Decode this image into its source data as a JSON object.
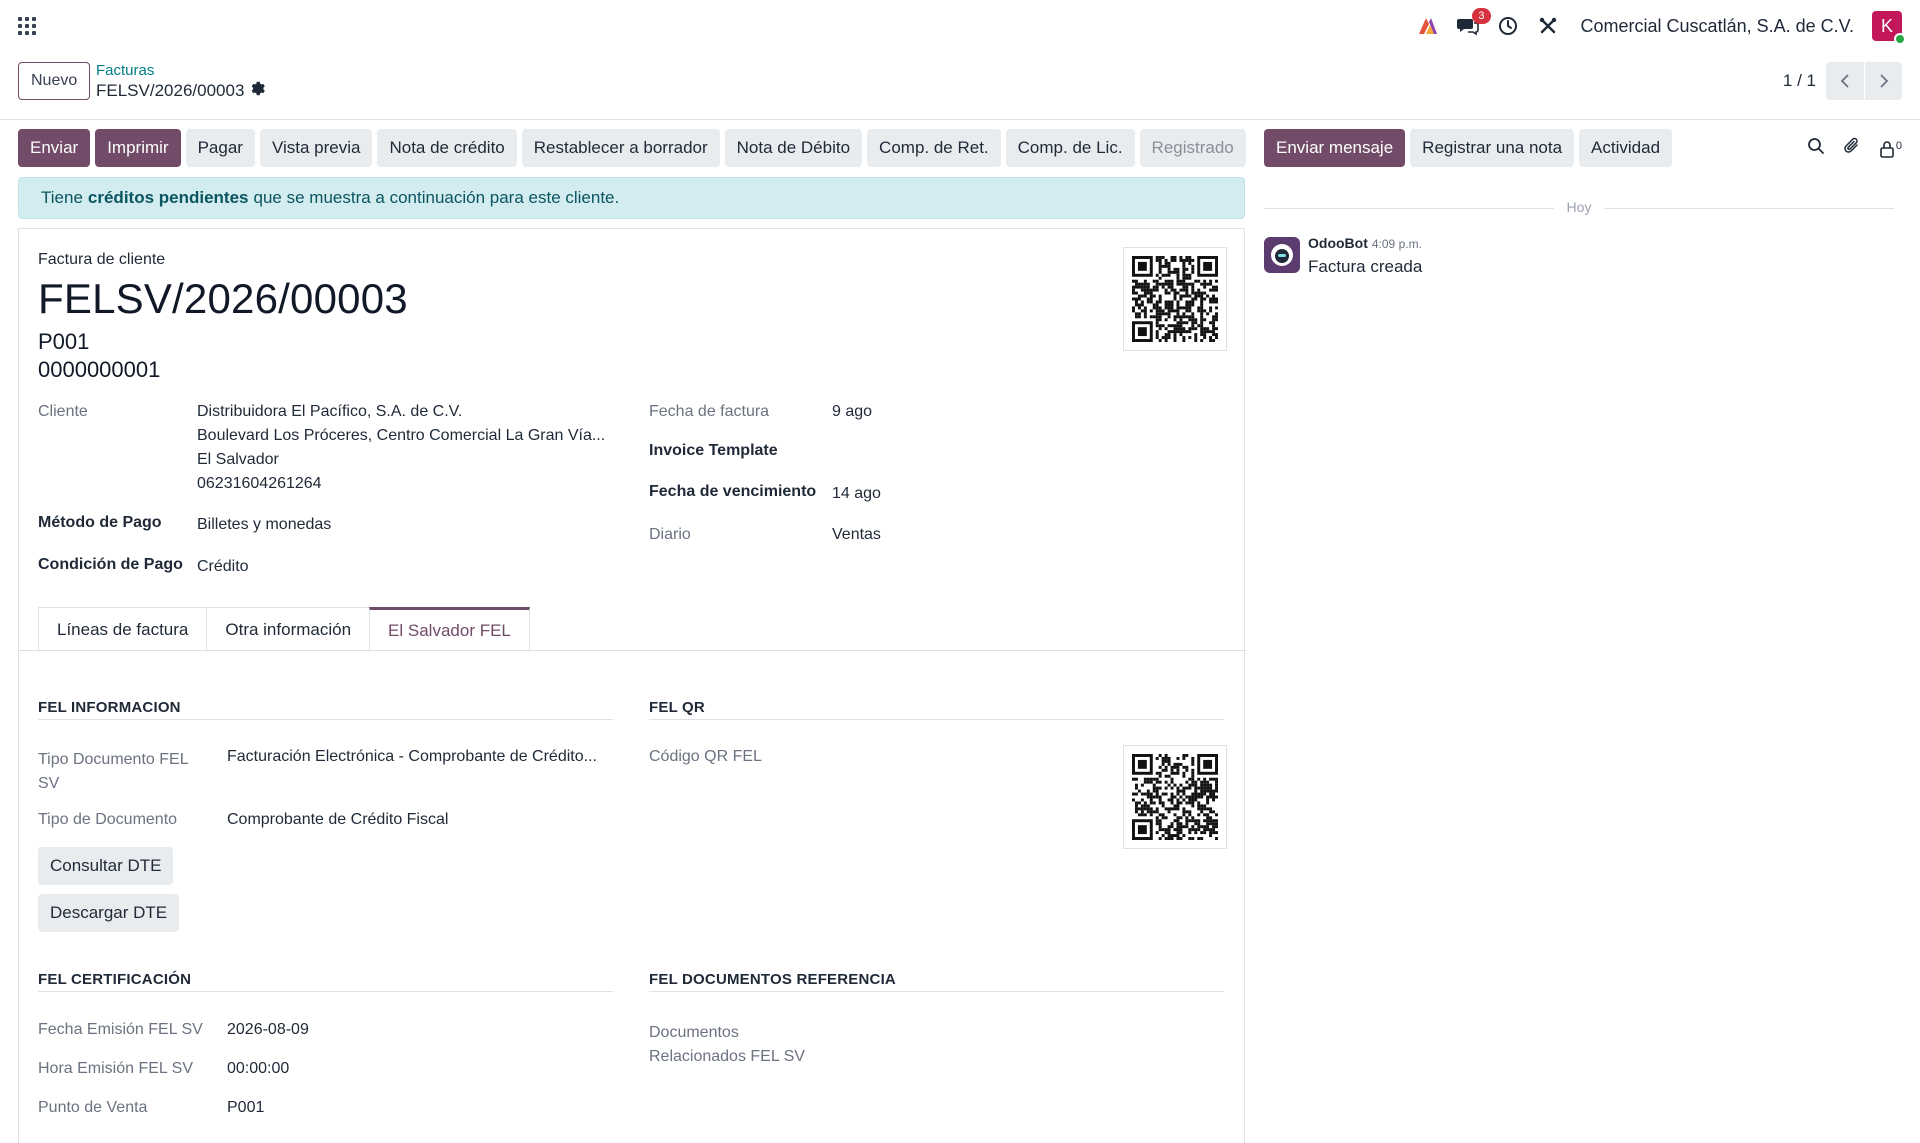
{
  "navbar": {
    "company": "Comercial Cuscatlán, S.A. de C.V.",
    "messages_badge": "3",
    "avatar_initial": "K"
  },
  "control_panel": {
    "new_label": "Nuevo",
    "breadcrumb_parent": "Facturas",
    "breadcrumb_current": "FELSV/2026/00003",
    "pager": "1 / 1"
  },
  "statusbar": {
    "buttons": [
      "Enviar",
      "Imprimir",
      "Pagar",
      "Vista previa",
      "Nota de crédito",
      "Restablecer a borrador",
      "Nota de Débito",
      "Comp. de Ret.",
      "Comp. de Lic."
    ],
    "state": "Registrado"
  },
  "alert": {
    "prefix": "Tiene",
    "bold": "créditos pendientes",
    "suffix": "que se muestra a continuación para este cliente."
  },
  "invoice": {
    "doc_type": "Factura de cliente",
    "number": "FELSV/2026/00003",
    "pos_code": "P001",
    "control_number": "0000000001",
    "customer_label": "Cliente",
    "customer_name": "Distribuidora El Pacífico, S.A. de C.V.",
    "customer_address": "Boulevard Los Próceres, Centro Comercial La Gran Vía...",
    "customer_country": "El Salvador",
    "customer_nit": "06231604261264",
    "payment_method_label": "Método de Pago",
    "payment_method": "Billetes y monedas",
    "payment_condition_label": "Condición de Pago",
    "payment_condition": "Crédito",
    "invoice_date_label": "Fecha de factura",
    "invoice_date": "9 ago",
    "invoice_template_label": "Invoice Template",
    "due_date_label": "Fecha de vencimiento",
    "due_date": "14 ago",
    "journal_label": "Diario",
    "journal": "Ventas"
  },
  "tabs": [
    "Líneas de factura",
    "Otra información",
    "El Salvador FEL"
  ],
  "fel": {
    "info_title": "FEL INFORMACION",
    "qr_title": "FEL QR",
    "doc_type_fel_label": "Tipo Documento FEL SV",
    "doc_type_fel": "Facturación Electrónica - Comprobante de Crédito...",
    "doc_type_label": "Tipo de Documento",
    "doc_type": "Comprobante de Crédito Fiscal",
    "qr_label": "Código QR FEL",
    "consult_button": "Consultar DTE",
    "download_button": "Descargar DTE",
    "cert_title": "FEL CERTIFICACIÓN",
    "refs_title": "FEL DOCUMENTOS REFERENCIA",
    "emission_date_label": "Fecha Emisión FEL SV",
    "emission_date": "2026-08-09",
    "emission_time_label": "Hora Emisión FEL SV",
    "emission_time": "00:00:00",
    "pos_label": "Punto de Venta",
    "pos": "P001",
    "related_docs_label": "Documentos Relacionados FEL SV"
  },
  "chatter": {
    "send_message": "Enviar mensaje",
    "log_note": "Registrar una nota",
    "activity": "Actividad",
    "followers_count": "0",
    "today_label": "Hoy",
    "author": "OdooBot",
    "time": "4:09 p.m.",
    "body": "Factura creada"
  }
}
